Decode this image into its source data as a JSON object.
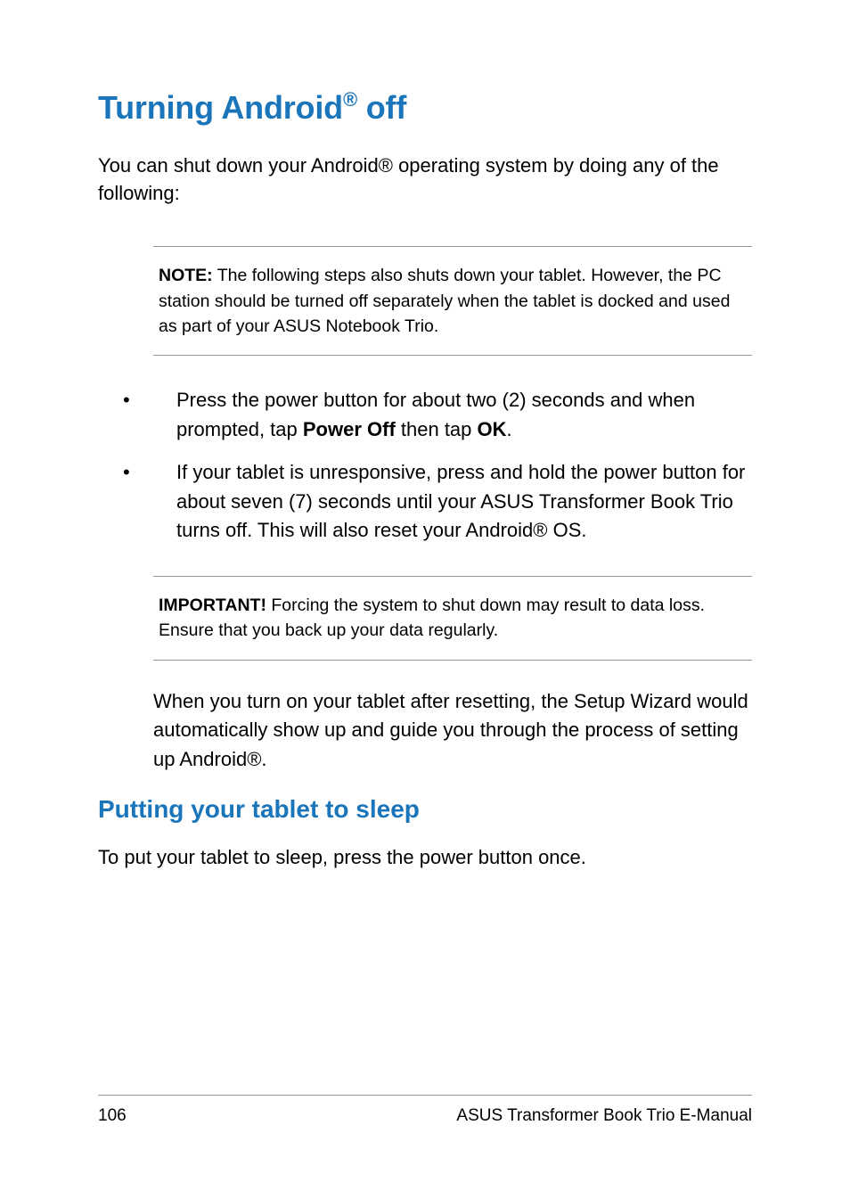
{
  "heading1_pre": "Turning Android",
  "heading1_sup": "®",
  "heading1_post": " off",
  "intro": "You can shut down your Android® operating system by doing any of the following:",
  "note_label": "NOTE:",
  "note_text": " The following steps also shuts down your tablet. However, the PC station should be turned off separately when the tablet is docked and used as part of your ASUS Notebook Trio.",
  "bullet1_pre": "Press  the power button for about two (2) seconds and when prompted, tap ",
  "bullet1_b1": "Power Off",
  "bullet1_mid": " then tap ",
  "bullet1_b2": "OK",
  "bullet1_end": ".",
  "bullet2": "If your tablet is unresponsive, press and hold the power button for about  seven (7) seconds until your ASUS Transformer Book Trio turns off. This will also reset your Android® OS.",
  "important_label": "IMPORTANT!",
  "important_text": "  Forcing the system to shut down may result to data loss. Ensure that you back up your data regularly.",
  "after_important": "When you turn on your tablet after resetting, the Setup Wizard would automatically show up and guide you through the process of setting up Android®.",
  "heading2": "Putting your tablet to sleep",
  "sleep_text": "To put your tablet to sleep, press the power button once.",
  "page_number": "106",
  "footer_title": "ASUS Transformer Book Trio E-Manual"
}
